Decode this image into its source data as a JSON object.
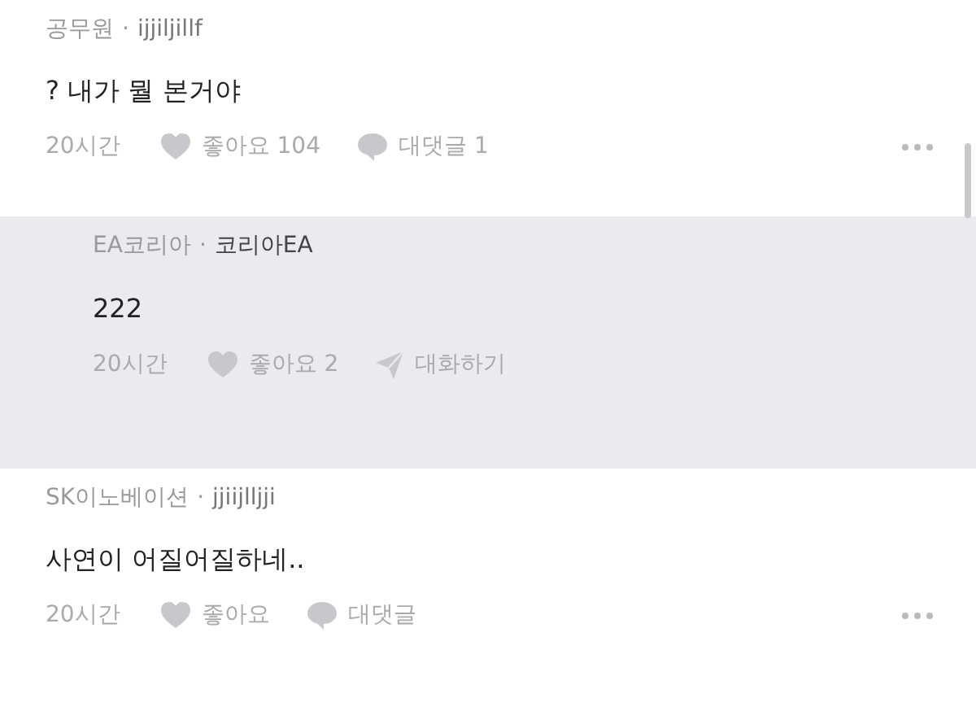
{
  "comments": [
    {
      "kind": "comment",
      "company": "공무원",
      "separator": "·",
      "nickname": "ijjiljillf",
      "body": "? 내가 뭘 본거야",
      "time": "20시간",
      "likes": "좋아요 104",
      "action": "대댓글 1"
    },
    {
      "kind": "reply",
      "company": "EA코리아",
      "separator": "·",
      "nickname": "코리아EA",
      "body": "222",
      "time": "20시간",
      "likes": "좋아요 2",
      "action": "대화하기"
    },
    {
      "kind": "comment",
      "company": "SK이노베이션",
      "separator": "·",
      "nickname": "jjiijlljji",
      "body": "사연이 어질어질하네..",
      "time": "20시간",
      "likes": "좋아요",
      "action": "대댓글"
    }
  ]
}
